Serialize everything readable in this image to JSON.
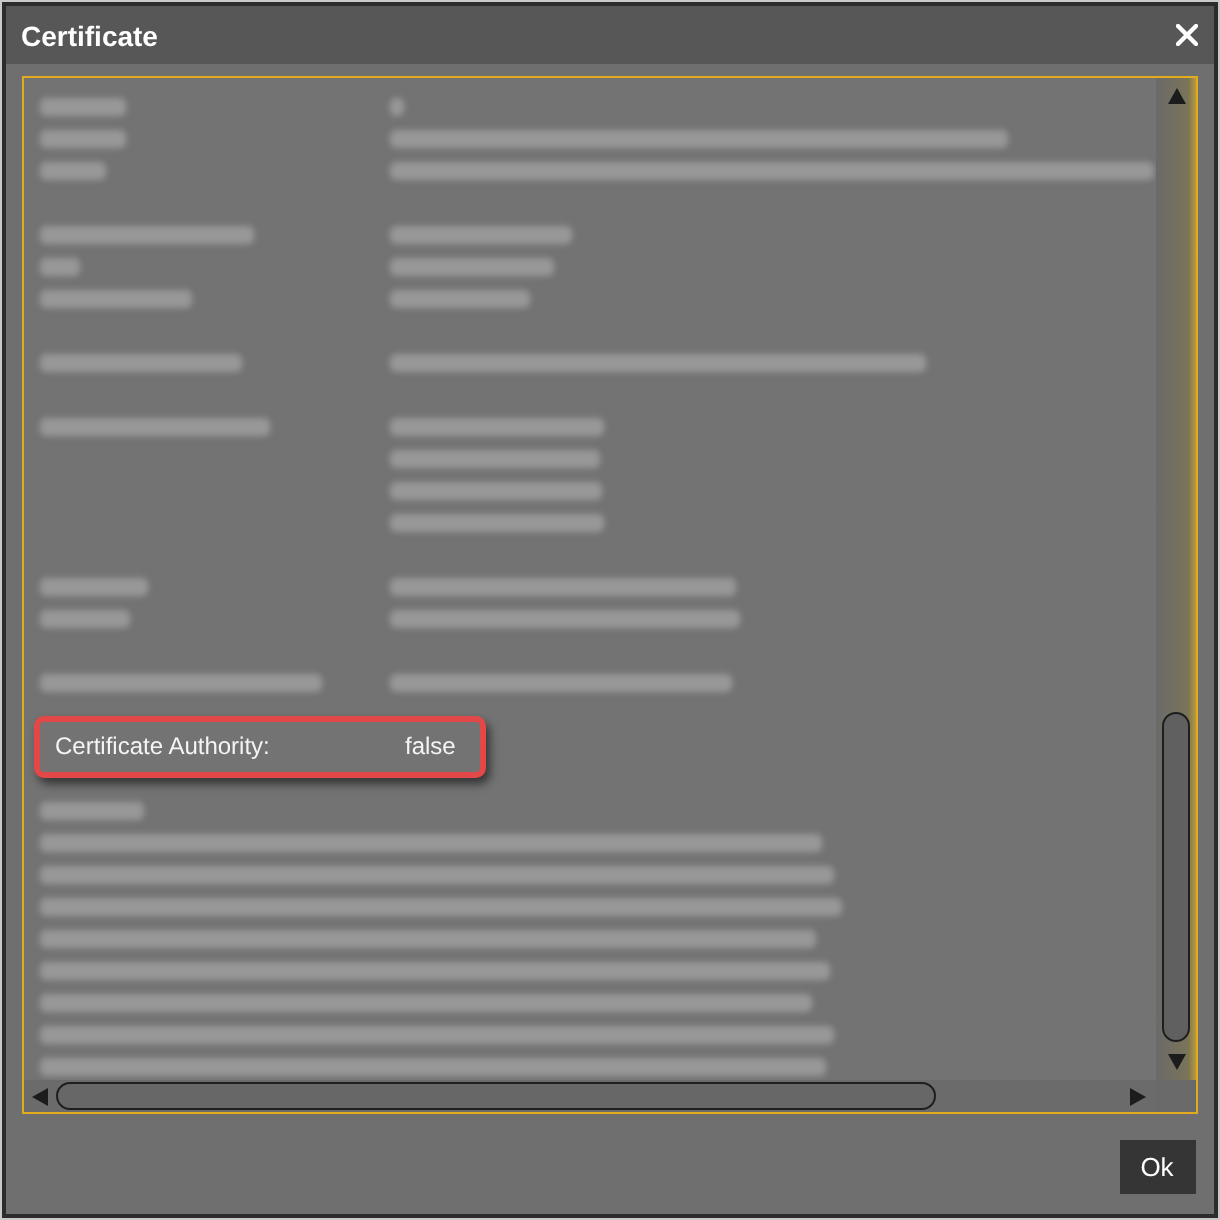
{
  "window": {
    "title": "Certificate"
  },
  "highlighted_field": {
    "label": "Certificate Authority:",
    "value": "false"
  },
  "buttons": [
    {
      "label": "Ok"
    }
  ]
}
